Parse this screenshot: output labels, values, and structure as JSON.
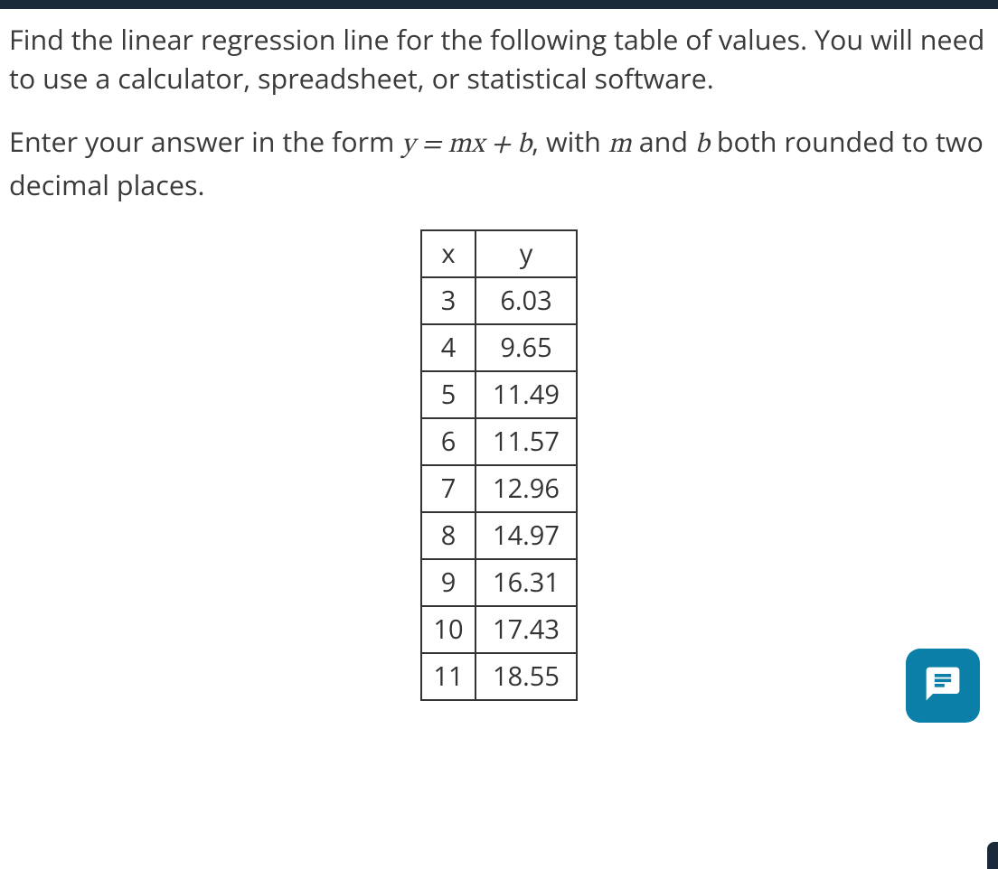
{
  "problem": {
    "paragraph1": "Find the linear regression line for the following table of values. You will need to use a calculator, spreadsheet, or statistical software.",
    "paragraph2_prefix": "Enter your answer in the form ",
    "equation": "y = mx + b",
    "paragraph2_mid": ", with ",
    "var_m": "m",
    "paragraph2_and": " and ",
    "var_b": "b",
    "paragraph2_suffix": " both rounded to two decimal places."
  },
  "table": {
    "headers": {
      "x": "x",
      "y": "y"
    },
    "rows": [
      {
        "x": "3",
        "y": "6.03"
      },
      {
        "x": "4",
        "y": "9.65"
      },
      {
        "x": "5",
        "y": "11.49"
      },
      {
        "x": "6",
        "y": "11.57"
      },
      {
        "x": "7",
        "y": "12.96"
      },
      {
        "x": "8",
        "y": "14.97"
      },
      {
        "x": "9",
        "y": "16.31"
      },
      {
        "x": "10",
        "y": "17.43"
      },
      {
        "x": "11",
        "y": "18.55"
      }
    ]
  },
  "chart_data": {
    "type": "table",
    "title": "Linear regression data",
    "columns": [
      "x",
      "y"
    ],
    "data": [
      [
        3,
        6.03
      ],
      [
        4,
        9.65
      ],
      [
        5,
        11.49
      ],
      [
        6,
        11.57
      ],
      [
        7,
        12.96
      ],
      [
        8,
        14.97
      ],
      [
        9,
        16.31
      ],
      [
        10,
        17.43
      ],
      [
        11,
        18.55
      ]
    ]
  }
}
